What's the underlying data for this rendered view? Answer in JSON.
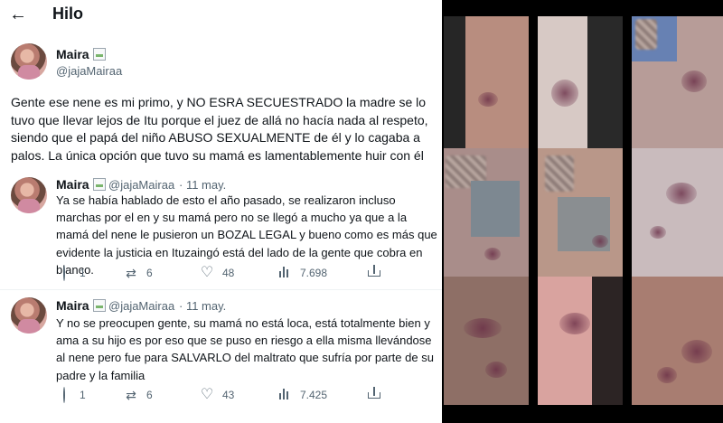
{
  "header": {
    "title": "Hilo",
    "back_icon": "arrow-left-icon"
  },
  "main_tweet": {
    "name": "Maira",
    "handle": "@jajaMairaa",
    "text": "Gente ese nene es mi primo, y NO ESRA SECUESTRADO la madre se lo tuvo que llevar lejos de Itu porque el juez de allá no hacía nada al respeto, siendo que el papá del niño ABUSO SEXUALMENTE de él y lo cagaba a palos. La única opción que tuvo su mamá es lamentablemente huir con él"
  },
  "replies": [
    {
      "name": "Maira",
      "handle": "@jajaMairaa",
      "date": "· 11 may.",
      "text": "Ya se había hablado de esto el año pasado, se realizaron incluso marchas por el en y su mamá pero no se llegó a mucho ya que a la mamá del nene le pusieron un BOZAL LEGAL y bueno  como es más que evidente la justicia en Ituzaingó está del lado de la gente que cobra en blanco.",
      "replies": "1",
      "retweets": "6",
      "likes": "48",
      "views": "7.698"
    },
    {
      "name": "Maira",
      "handle": "@jajaMairaa",
      "date": "· 11 may.",
      "text": "Y no se preocupen gente, su mamá no está loca, está totalmente bien y ama a su hijo es por eso que se puso en riesgo a ella misma llevándose al nene pero fue para SALVARLO del maltrato que sufría por parte de su padre y la familia",
      "replies": "1",
      "retweets": "6",
      "likes": "43",
      "views": "7.425"
    }
  ],
  "colors": {
    "text": "#0f1419",
    "secondary": "#536471",
    "divider": "#eff3f4",
    "background": "#ffffff",
    "gallery_background": "#000000"
  }
}
